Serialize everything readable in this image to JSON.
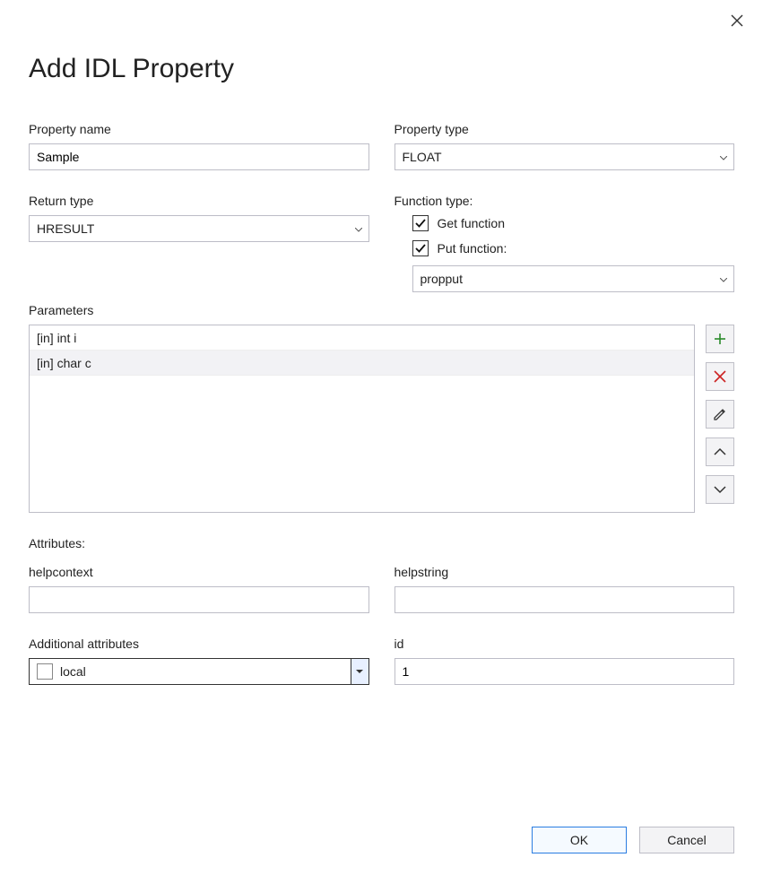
{
  "dialog": {
    "title": "Add IDL Property"
  },
  "labels": {
    "property_name": "Property name",
    "property_type": "Property type",
    "return_type": "Return type",
    "function_type": "Function type:",
    "get_function": "Get function",
    "put_function": "Put function:",
    "parameters": "Parameters",
    "attributes": "Attributes:",
    "helpcontext": "helpcontext",
    "helpstring": "helpstring",
    "additional_attributes": "Additional attributes",
    "id": "id"
  },
  "values": {
    "property_name": "Sample",
    "property_type": "FLOAT",
    "return_type": "HRESULT",
    "put_mode": "propput",
    "helpcontext": "",
    "helpstring": "",
    "additional_value": "local",
    "id": "1"
  },
  "checks": {
    "get_function": true,
    "put_function": true,
    "additional_local": false
  },
  "parameters": [
    "[in] int i",
    "[in] char c"
  ],
  "buttons": {
    "ok": "OK",
    "cancel": "Cancel"
  }
}
